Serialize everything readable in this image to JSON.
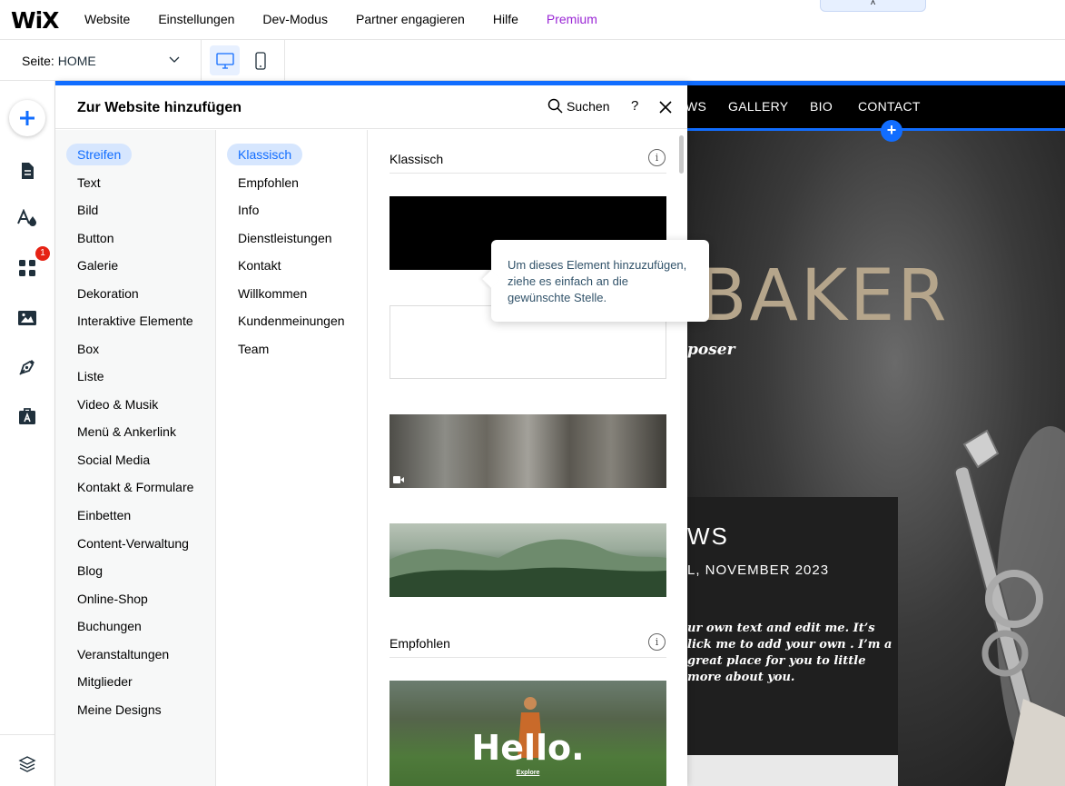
{
  "topbar": {
    "logo": "WiX",
    "menu": [
      "Website",
      "Einstellungen",
      "Dev-Modus",
      "Partner engagieren",
      "Hilfe"
    ],
    "premium": "Premium",
    "collapse_glyph": "˄"
  },
  "secondbar": {
    "page_label": "Seite:",
    "page_value": "HOME"
  },
  "rail": {
    "badge_count": "1",
    "icons": [
      "add-icon",
      "pages-icon",
      "theme-icon",
      "apps-icon",
      "media-icon",
      "pen-icon",
      "portfolio-icon",
      "layers-icon"
    ]
  },
  "panel": {
    "title": "Zur Website hinzufügen",
    "search_label": "Suchen",
    "help_label": "?",
    "categories": [
      "Streifen",
      "Text",
      "Bild",
      "Button",
      "Galerie",
      "Dekoration",
      "Interaktive Elemente",
      "Box",
      "Liste",
      "Video & Musik",
      "Menü & Ankerlink",
      "Social Media",
      "Kontakt & Formulare",
      "Einbetten",
      "Content-Verwaltung",
      "Blog",
      "Online-Shop",
      "Buchungen",
      "Veranstaltungen",
      "Mitglieder",
      "Meine Designs"
    ],
    "subcategories": [
      "Klassisch",
      "Empfohlen",
      "Info",
      "Dienstleistungen",
      "Kontakt",
      "Willkommen",
      "Kundenmeinungen",
      "Team"
    ],
    "sections": [
      {
        "title": "Klassisch",
        "info": "i"
      },
      {
        "title": "Empfohlen",
        "info": "i"
      }
    ],
    "hello_thumb": {
      "title": "Hello.",
      "link": "Explore"
    }
  },
  "tooltip": {
    "text": "Um dieses Element hinzuzufügen, ziehe es einfach an die gewünschte Stelle."
  },
  "site": {
    "nav": [
      "WS",
      "GALLERY",
      "BIO",
      "CONTACT"
    ],
    "plus": "+",
    "title": "BAKER",
    "subtitle": "poser",
    "news_heading": "WS",
    "news_date": "L, NOVEMBER 2023",
    "news_text": "ur own text and edit me. It’s lick me to add your own . I’m a great place for you to little more about you."
  },
  "colors": {
    "accent": "#116dff",
    "premium": "#9a27d5",
    "badge": "#e62214",
    "site_title": "#b5a58b"
  }
}
